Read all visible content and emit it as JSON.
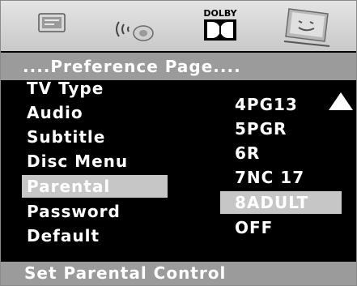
{
  "icon_bar": {
    "icons": [
      "general-setup-icon",
      "speaker-setup-icon",
      "dolby-setup-icon",
      "preference-setup-icon"
    ],
    "dolby_text": "DOLBY"
  },
  "title": "....Preference Page....",
  "menu": {
    "items": [
      "TV Type",
      "Audio",
      "Subtitle",
      "Disc Menu",
      "Parental",
      "Password",
      "Default"
    ],
    "selected": "Parental"
  },
  "options": {
    "items": [
      "4PG13",
      "5PGR",
      "6R",
      "7NC 17",
      "8ADULT",
      "OFF"
    ],
    "selected": "8ADULT"
  },
  "status": "Set Parental Control",
  "colors": {
    "bar": "#9b9b9b",
    "highlight": "#c6c6c6",
    "background": "#000000"
  }
}
